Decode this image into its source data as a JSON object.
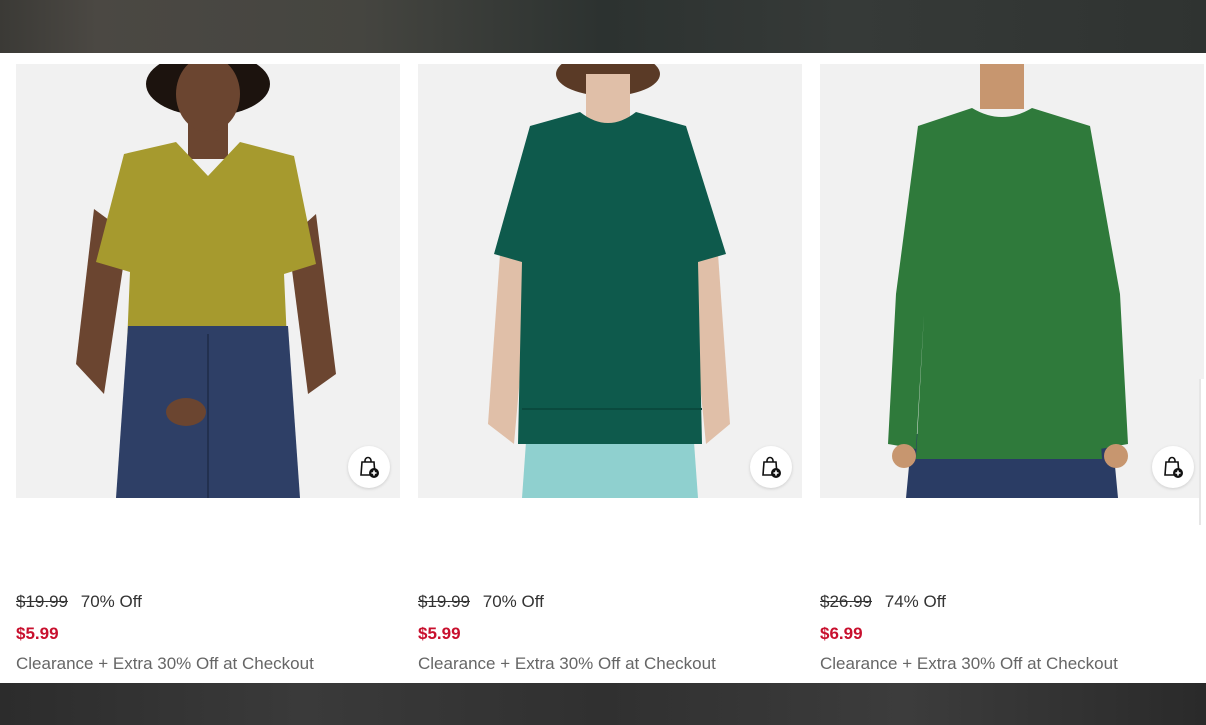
{
  "products": [
    {
      "id": "v-neck-tee",
      "image_alt": "Olive green v-neck t-shirt with blue jeans",
      "shirt_color": "#a69a2e",
      "bottom_color": "#2e3f66",
      "skin_color": "#6b4530",
      "original_price": "$19.99",
      "discount": "70% Off",
      "sale_price": "$5.99",
      "promo": "Clearance + Extra 30% Off at Checkout",
      "add_to_bag_icon": "shopping-bag-plus-icon"
    },
    {
      "id": "crew-neck-tee",
      "image_alt": "Dark teal crew-neck t-shirt with light blue bike shorts",
      "shirt_color": "#0e5a4c",
      "bottom_color": "#8fd0cf",
      "skin_color": "#e0bfa8",
      "original_price": "$19.99",
      "discount": "70% Off",
      "sale_price": "$5.99",
      "promo": "Clearance + Extra 30% Off at Checkout",
      "add_to_bag_icon": "shopping-bag-plus-icon"
    },
    {
      "id": "long-sleeve-tee",
      "image_alt": "Green long-sleeve t-shirt with blue jeans",
      "shirt_color": "#2f7a3b",
      "bottom_color": "#2a3c64",
      "skin_color": "#c7966f",
      "original_price": "$26.99",
      "discount": "74% Off",
      "sale_price": "$6.99",
      "promo": "Clearance + Extra 30% Off at Checkout",
      "add_to_bag_icon": "shopping-bag-plus-icon"
    }
  ],
  "colors": {
    "sale_price": "#c8102e",
    "promo_text": "#666666",
    "photo_background": "#f1f1f1"
  }
}
